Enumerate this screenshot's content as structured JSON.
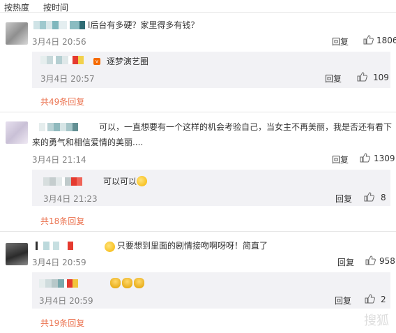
{
  "sort": {
    "by_heat": "按热度",
    "by_time": "按时间"
  },
  "comments": [
    {
      "text": "l后台有多硬？家里得多有钱？",
      "time": "3月4日 20:56",
      "reply": "回复",
      "likes": "1806",
      "sub": {
        "text": "逐梦演艺圈",
        "time": "3月4日 20:57",
        "reply": "回复",
        "likes": "109"
      },
      "more": "共49条回复"
    },
    {
      "text_line1": "可以，一直想要有一个这样的机会考验自己，当女主不再美丽，我是否还有看下",
      "text_line2": "来的勇气和相信爱情的美丽....",
      "time": "3月4日 21:14",
      "reply": "回复",
      "likes": "1309",
      "sub": {
        "text": "可以可以",
        "time": "3月4日 21:23",
        "reply": "回复",
        "likes": "8"
      },
      "more": "共18条回复"
    },
    {
      "text": "只要想到里面的剧情接吻啊呀呀！简直了",
      "time": "3月4日 20:59",
      "reply": "回复",
      "likes": "958",
      "sub": {
        "time": "3月4日 20:59",
        "reply": "回复",
        "likes": "2"
      },
      "more": "共19条回复"
    }
  ],
  "watermark": "搜狐"
}
